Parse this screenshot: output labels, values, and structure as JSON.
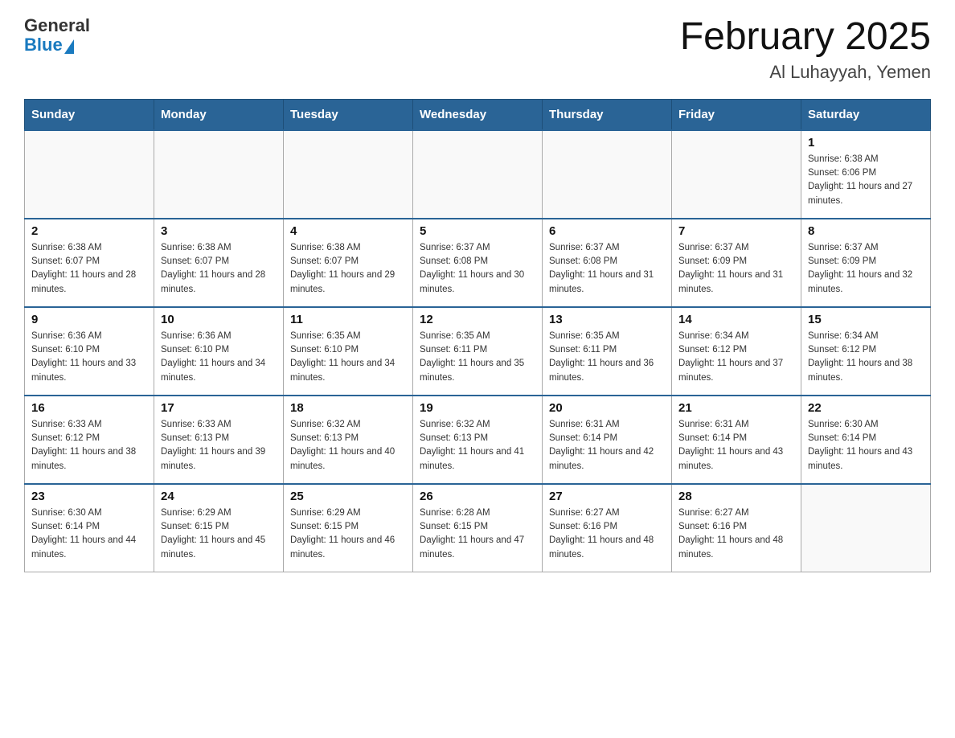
{
  "header": {
    "logo_general": "General",
    "logo_blue": "Blue",
    "title": "February 2025",
    "subtitle": "Al Luhayyah, Yemen"
  },
  "days_of_week": [
    "Sunday",
    "Monday",
    "Tuesday",
    "Wednesday",
    "Thursday",
    "Friday",
    "Saturday"
  ],
  "weeks": [
    [
      {
        "day": "",
        "info": ""
      },
      {
        "day": "",
        "info": ""
      },
      {
        "day": "",
        "info": ""
      },
      {
        "day": "",
        "info": ""
      },
      {
        "day": "",
        "info": ""
      },
      {
        "day": "",
        "info": ""
      },
      {
        "day": "1",
        "info": "Sunrise: 6:38 AM\nSunset: 6:06 PM\nDaylight: 11 hours and 27 minutes."
      }
    ],
    [
      {
        "day": "2",
        "info": "Sunrise: 6:38 AM\nSunset: 6:07 PM\nDaylight: 11 hours and 28 minutes."
      },
      {
        "day": "3",
        "info": "Sunrise: 6:38 AM\nSunset: 6:07 PM\nDaylight: 11 hours and 28 minutes."
      },
      {
        "day": "4",
        "info": "Sunrise: 6:38 AM\nSunset: 6:07 PM\nDaylight: 11 hours and 29 minutes."
      },
      {
        "day": "5",
        "info": "Sunrise: 6:37 AM\nSunset: 6:08 PM\nDaylight: 11 hours and 30 minutes."
      },
      {
        "day": "6",
        "info": "Sunrise: 6:37 AM\nSunset: 6:08 PM\nDaylight: 11 hours and 31 minutes."
      },
      {
        "day": "7",
        "info": "Sunrise: 6:37 AM\nSunset: 6:09 PM\nDaylight: 11 hours and 31 minutes."
      },
      {
        "day": "8",
        "info": "Sunrise: 6:37 AM\nSunset: 6:09 PM\nDaylight: 11 hours and 32 minutes."
      }
    ],
    [
      {
        "day": "9",
        "info": "Sunrise: 6:36 AM\nSunset: 6:10 PM\nDaylight: 11 hours and 33 minutes."
      },
      {
        "day": "10",
        "info": "Sunrise: 6:36 AM\nSunset: 6:10 PM\nDaylight: 11 hours and 34 minutes."
      },
      {
        "day": "11",
        "info": "Sunrise: 6:35 AM\nSunset: 6:10 PM\nDaylight: 11 hours and 34 minutes."
      },
      {
        "day": "12",
        "info": "Sunrise: 6:35 AM\nSunset: 6:11 PM\nDaylight: 11 hours and 35 minutes."
      },
      {
        "day": "13",
        "info": "Sunrise: 6:35 AM\nSunset: 6:11 PM\nDaylight: 11 hours and 36 minutes."
      },
      {
        "day": "14",
        "info": "Sunrise: 6:34 AM\nSunset: 6:12 PM\nDaylight: 11 hours and 37 minutes."
      },
      {
        "day": "15",
        "info": "Sunrise: 6:34 AM\nSunset: 6:12 PM\nDaylight: 11 hours and 38 minutes."
      }
    ],
    [
      {
        "day": "16",
        "info": "Sunrise: 6:33 AM\nSunset: 6:12 PM\nDaylight: 11 hours and 38 minutes."
      },
      {
        "day": "17",
        "info": "Sunrise: 6:33 AM\nSunset: 6:13 PM\nDaylight: 11 hours and 39 minutes."
      },
      {
        "day": "18",
        "info": "Sunrise: 6:32 AM\nSunset: 6:13 PM\nDaylight: 11 hours and 40 minutes."
      },
      {
        "day": "19",
        "info": "Sunrise: 6:32 AM\nSunset: 6:13 PM\nDaylight: 11 hours and 41 minutes."
      },
      {
        "day": "20",
        "info": "Sunrise: 6:31 AM\nSunset: 6:14 PM\nDaylight: 11 hours and 42 minutes."
      },
      {
        "day": "21",
        "info": "Sunrise: 6:31 AM\nSunset: 6:14 PM\nDaylight: 11 hours and 43 minutes."
      },
      {
        "day": "22",
        "info": "Sunrise: 6:30 AM\nSunset: 6:14 PM\nDaylight: 11 hours and 43 minutes."
      }
    ],
    [
      {
        "day": "23",
        "info": "Sunrise: 6:30 AM\nSunset: 6:14 PM\nDaylight: 11 hours and 44 minutes."
      },
      {
        "day": "24",
        "info": "Sunrise: 6:29 AM\nSunset: 6:15 PM\nDaylight: 11 hours and 45 minutes."
      },
      {
        "day": "25",
        "info": "Sunrise: 6:29 AM\nSunset: 6:15 PM\nDaylight: 11 hours and 46 minutes."
      },
      {
        "day": "26",
        "info": "Sunrise: 6:28 AM\nSunset: 6:15 PM\nDaylight: 11 hours and 47 minutes."
      },
      {
        "day": "27",
        "info": "Sunrise: 6:27 AM\nSunset: 6:16 PM\nDaylight: 11 hours and 48 minutes."
      },
      {
        "day": "28",
        "info": "Sunrise: 6:27 AM\nSunset: 6:16 PM\nDaylight: 11 hours and 48 minutes."
      },
      {
        "day": "",
        "info": ""
      }
    ]
  ]
}
